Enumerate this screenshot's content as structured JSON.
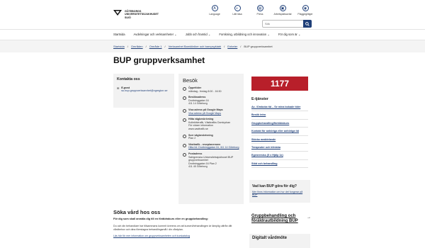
{
  "logo": {
    "line1": "GÖTEBORGS",
    "line2": "UNIVERSITETSSJUKHUSET",
    "line3": "SU/Ö"
  },
  "top_icons": [
    {
      "icon": "translate-icon",
      "label": "Language"
    },
    {
      "icon": "ear-icon",
      "label": "Lätt läsa"
    },
    {
      "icon": "book-icon",
      "label": "Press"
    },
    {
      "icon": "handbook-icon",
      "label": "Arbetsplatsavtal"
    },
    {
      "icon": "dashboard-icon",
      "label": "Plaggegiltiger"
    }
  ],
  "search": {
    "placeholder": "Sök"
  },
  "nav": [
    "Startsida",
    "Avdelningar och verksamheter  ⌄",
    "Jobb och framtid  ⌄",
    "Forskning, utbildning och innovation  ⌄",
    "För dig som är  ⌄"
  ],
  "breadcrumb": [
    "Startsida",
    "Områden",
    "Område 1",
    "Verksamhet Barnkliniker och barnpsykiatri",
    "Enheter",
    "BUP gruppverksamhet"
  ],
  "page_title": "BUP gruppverksamhet",
  "kontakt": {
    "title": "Kontakta oss",
    "email_label": "E-post",
    "email_value": "su.bup.gruppverksamhet@vgregion.se"
  },
  "besok": {
    "title": "Besök",
    "items": [
      {
        "icon": "clock-icon",
        "title": "Öppettider",
        "lines": [
          "måndag - fredag 8:00 - 16:30"
        ],
        "link": ""
      },
      {
        "icon": "pin-icon",
        "title": "Besöksadress",
        "lines": [
          "Drottninggatan 16",
          "411 14 Göteborg"
        ],
        "link": ""
      },
      {
        "icon": "map-icon",
        "title": "Visa adress på Google Maps",
        "lines": [],
        "link": "Visa adress på Google Maps"
      },
      {
        "icon": "sign-icon",
        "title": "Hitta vägbeskrivning",
        "lines": [
          "Kollektivtrafik, Västtrafiks Domkyrkan",
          "För vidare information",
          "www.vasttrafik.se"
        ],
        "link": ""
      },
      {
        "icon": "signpost-icon",
        "title": "Sorr vägbeskrivning",
        "lines": [
          "Plan 2"
        ],
        "link": ""
      },
      {
        "icon": "bus-icon",
        "title": "Västtrafik - reseplaneraren",
        "lines": [],
        "link": "Hitta hit: Drottninggatan 16, 411 14 Göteborg"
      },
      {
        "icon": "mail-icon",
        "title": "Postadress",
        "lines": [
          "Sahlgrenska Universitetssjukhuset BUP",
          "gruppverksamhet",
          "Drottninggatan 16 Plan 2",
          "411 45 Göteborg"
        ],
        "link": ""
      }
    ]
  },
  "badge": "1177",
  "etjanster": {
    "title": "E-tjänster",
    "links": [
      "Av- /Ombokа tid – Se mina bokade tider",
      "Besök intro",
      "Gruppbehandling/föräldrakurs",
      "Kontakt för anhöriga eller anhöriga tid",
      "Skicka meddelande",
      "Terapeuter och kliniska",
      "Egenremiss (5 x Hjälp 1x)",
      "Stöd och behandling"
    ]
  },
  "vad_kan": {
    "title": "Vad kan BUP göra för dig?",
    "link": "Mer finns information om hur det fungerar på BUP"
  },
  "gruppbehandling": {
    "link": "Gruppbehandling och föräldrautbildning BUP"
  },
  "digitalt": {
    "title": "Digitalt vårdmöte"
  },
  "soka": {
    "title": "Söka vård hos oss",
    "p1": "För dig som skall anmäla dig till en föräldrakurs eller en gruppbehandling:",
    "p2": "Du och din behandlare har tillsammans kommit överens om att kursen/behandlingen är lämplig utifrån ditt vårdbehov och dina föreslagna behandlingsmål i din vårdplan.",
    "p3": "Läs här för mer information om gruppverksamheten och kurskatalog"
  }
}
